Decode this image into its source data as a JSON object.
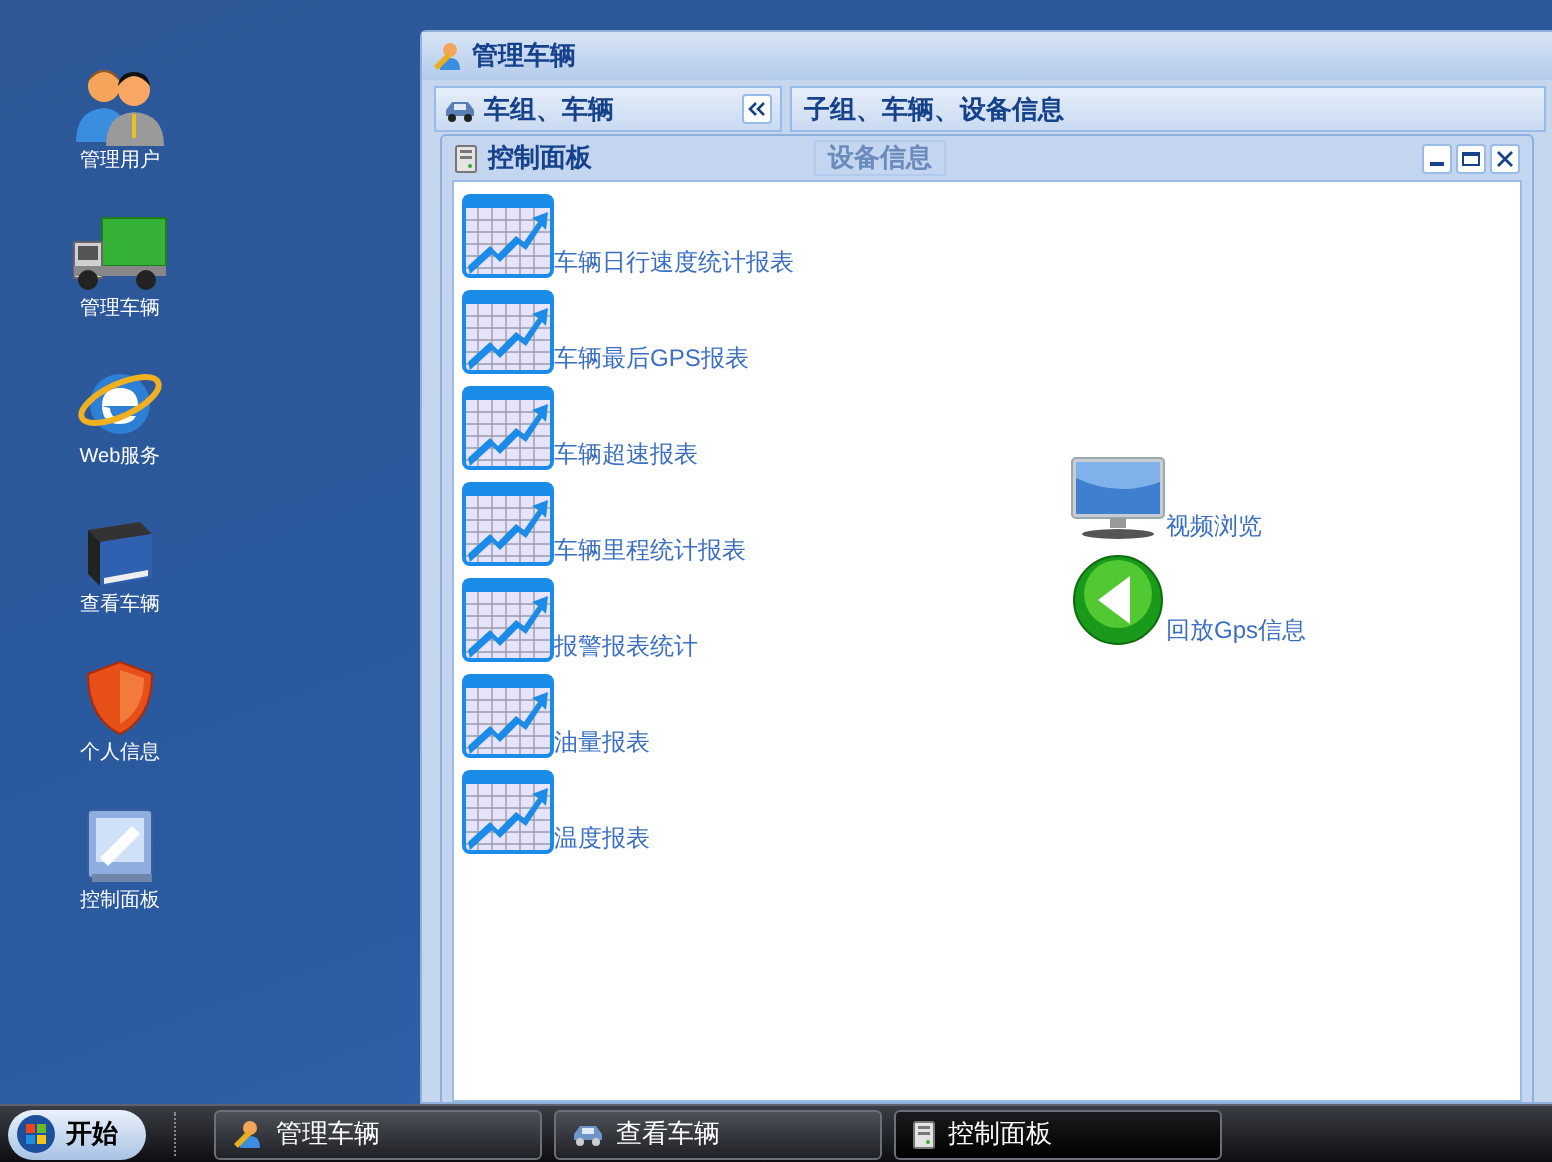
{
  "desktop_icons": [
    {
      "label": "管理用户",
      "kind": "users"
    },
    {
      "label": "管理车辆",
      "kind": "truck"
    },
    {
      "label": "Web服务",
      "kind": "web"
    },
    {
      "label": "查看车辆",
      "kind": "book"
    },
    {
      "label": "个人信息",
      "kind": "shield"
    },
    {
      "label": "控制面板",
      "kind": "panel"
    }
  ],
  "window": {
    "title": "管理车辆",
    "left_panel": {
      "title": "车组、车辆"
    },
    "right_panel": {
      "title": "子组、车辆、设备信息"
    },
    "background_tab": "设备信息"
  },
  "control_panel": {
    "title": "控制面板",
    "reports": [
      "车辆日行速度统计报表",
      "车辆最后GPS报表",
      "车辆超速报表",
      "车辆里程统计报表",
      "报警报表统计",
      "油量报表",
      "温度报表"
    ],
    "shortcuts": [
      {
        "label": "视频浏览",
        "kind": "monitor"
      },
      {
        "label": "回放Gps信息",
        "kind": "playback"
      }
    ]
  },
  "taskbar": {
    "start": "开始",
    "tasks": [
      {
        "label": "管理车辆",
        "kind": "manage",
        "selected": false
      },
      {
        "label": "查看车辆",
        "kind": "car",
        "selected": false
      },
      {
        "label": "控制面板",
        "kind": "server",
        "selected": true
      }
    ]
  }
}
